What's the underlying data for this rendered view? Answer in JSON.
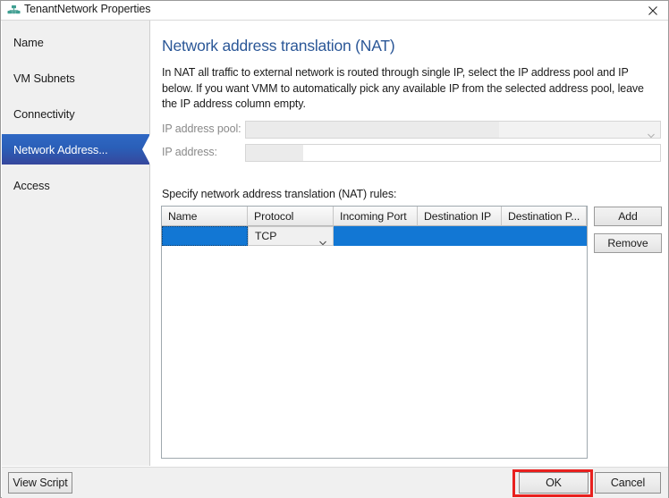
{
  "window": {
    "title": "TenantNetwork Properties",
    "icon": "network-adapter-icon",
    "close_label": "✕"
  },
  "sidebar": {
    "items": [
      {
        "label": "Name",
        "selected": false
      },
      {
        "label": "VM Subnets",
        "selected": false
      },
      {
        "label": "Connectivity",
        "selected": false
      },
      {
        "label": "Network Address...",
        "selected": true
      },
      {
        "label": "Access",
        "selected": false
      }
    ]
  },
  "content": {
    "title": "Network address translation (NAT)",
    "description": "In NAT all traffic to external network is routed through single IP, select the IP address pool and IP below. If you want VMM to automatically pick any available IP from the selected address pool, leave the IP address column empty.",
    "fields": [
      {
        "label": "IP address pool:",
        "value": "",
        "placeholder": "",
        "type": "combobox",
        "disabled": true
      },
      {
        "label": "IP address:",
        "value": "",
        "placeholder": "",
        "type": "text",
        "disabled": true
      }
    ],
    "rules_label": "Specify network address translation (NAT) rules:",
    "grid": {
      "columns": [
        {
          "header": "Name",
          "width": 96
        },
        {
          "header": "Protocol",
          "width": 96
        },
        {
          "header": "Incoming Port",
          "width": 94
        },
        {
          "header": "Destination IP",
          "width": 94
        },
        {
          "header": "Destination P...",
          "width": 95
        }
      ],
      "rows": [
        {
          "selected": true,
          "cells": [
            {
              "value": "",
              "editor": "text",
              "focused": true
            },
            {
              "value": "TCP",
              "editor": "dropdown",
              "focused": false
            },
            {
              "value": "",
              "editor": "text",
              "focused": false
            },
            {
              "value": "",
              "editor": "text",
              "focused": false
            },
            {
              "value": "",
              "editor": "text",
              "focused": false
            }
          ]
        }
      ]
    },
    "side_buttons": [
      {
        "label": "Add"
      },
      {
        "label": "Remove"
      }
    ]
  },
  "footer": {
    "view_script_label": "View Script",
    "ok_label": "OK",
    "cancel_label": "Cancel"
  },
  "annotation": {
    "highlight_color": "#e8201e",
    "target": "ok-button"
  },
  "colors": {
    "accent_title": "#2b5797",
    "selection_blue": "#1277d4",
    "nav_selected_blue": "#2a5fb8",
    "sidebar_bg": "#f0f0f0",
    "icon_teal": "#3a9a8f"
  }
}
